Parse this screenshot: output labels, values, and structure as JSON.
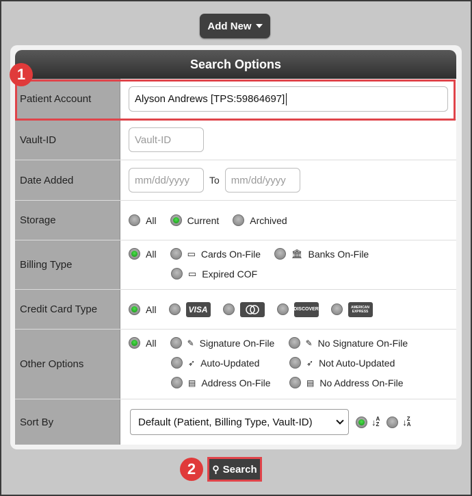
{
  "header": {
    "add_new_label": "Add New"
  },
  "panel": {
    "title": "Search Options"
  },
  "fields": {
    "patient_account": {
      "label": "Patient Account",
      "value": "Alyson Andrews [TPS:59864697]"
    },
    "vault_id": {
      "label": "Vault-ID",
      "placeholder": "Vault-ID"
    },
    "date_added": {
      "label": "Date Added",
      "from_placeholder": "mm/dd/yyyy",
      "to_label": "To",
      "to_placeholder": "mm/dd/yyyy"
    },
    "storage": {
      "label": "Storage",
      "options": [
        "All",
        "Current",
        "Archived"
      ],
      "selected": "Current"
    },
    "billing_type": {
      "label": "Billing Type",
      "options": [
        "All",
        "Cards On-File",
        "Banks On-File",
        "Expired COF"
      ],
      "selected": "All"
    },
    "credit_card_type": {
      "label": "Credit Card Type",
      "options": [
        "All",
        "VISA",
        "MasterCard",
        "DISCOVER",
        "AMERICAN EXPRESS"
      ],
      "selected": "All"
    },
    "other_options": {
      "label": "Other Options",
      "options": [
        "All",
        "Signature On-File",
        "No Signature On-File",
        "Auto-Updated",
        "Not Auto-Updated",
        "Address On-File",
        "No Address On-File"
      ],
      "selected": "All"
    },
    "sort_by": {
      "label": "Sort By",
      "value": "Default (Patient, Billing Type, Vault-ID)",
      "order_selected": "ascending"
    }
  },
  "actions": {
    "search_label": "Search"
  },
  "annotations": {
    "marker_1": "1",
    "marker_2": "2"
  },
  "colors": {
    "accent_green": "#1a9e1a",
    "highlight_red": "#e0444a",
    "header_dark": "#3a3a3a"
  }
}
